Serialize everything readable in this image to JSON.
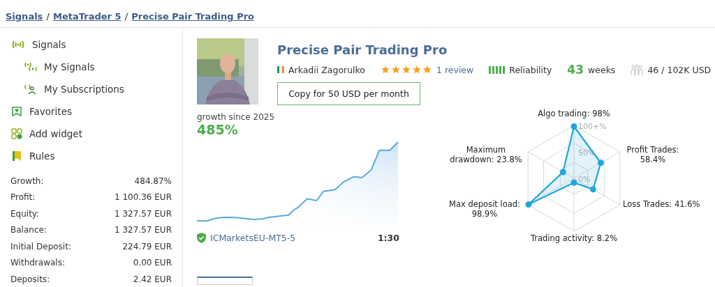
{
  "breadcrumb": [
    {
      "kind": "link",
      "text": "Signals"
    },
    {
      "kind": "separator",
      "text": "/"
    },
    {
      "kind": "link",
      "text": "MetaTrader 5"
    },
    {
      "kind": "separator",
      "text": "/"
    },
    {
      "kind": "link",
      "text": "Precise Pair Trading Pro"
    }
  ],
  "sidebar": {
    "items": [
      {
        "label": "Signals",
        "children": [
          {
            "label": "My Signals"
          },
          {
            "label": "My Subscriptions"
          }
        ]
      },
      {
        "label": "Favorites"
      },
      {
        "label": "Add widget"
      },
      {
        "label": "Rules"
      }
    ],
    "stats": [
      {
        "label": "Growth:",
        "value": "484.87%"
      },
      {
        "label": "Profit:",
        "value": "1 100.36 EUR"
      },
      {
        "label": "Equity:",
        "value": "1 327.57 EUR"
      },
      {
        "label": "Balance:",
        "value": "1 327.57 EUR"
      },
      {
        "label": "Initial Deposit:",
        "value": "224.79 EUR"
      },
      {
        "label": "Withdrawals:",
        "value": "0.00 EUR"
      },
      {
        "label": "Deposits:",
        "value": "2.42 EUR"
      }
    ]
  },
  "signal": {
    "title": "Precise Pair Trading Pro",
    "author": "Arkadii Zagorulko",
    "stars": 5,
    "reviews": "1 review",
    "reliability": "Reliability",
    "weeks_count": "43",
    "weeks_label": "weeks",
    "subscribers": "46 / 102K USD",
    "copy_button": "Copy for 50 USD per month"
  },
  "growth": {
    "caption": "growth since 2025",
    "value": "485%",
    "broker": "ICMarketsEU-MT5-5",
    "leverage": "1:30"
  },
  "radar": {
    "ring_labels": [
      "100+%",
      "50%",
      "0%"
    ],
    "axes": [
      {
        "label": "Algo trading: 98%"
      },
      {
        "label": "Maximum drawdown: 23.8%"
      },
      {
        "label": "Profit Trades: 58.4%"
      },
      {
        "label": "Max deposit load: 98.9%"
      },
      {
        "label": "Loss Trades: 41.6%"
      },
      {
        "label": "Trading activity: 8.2%"
      }
    ]
  }
}
